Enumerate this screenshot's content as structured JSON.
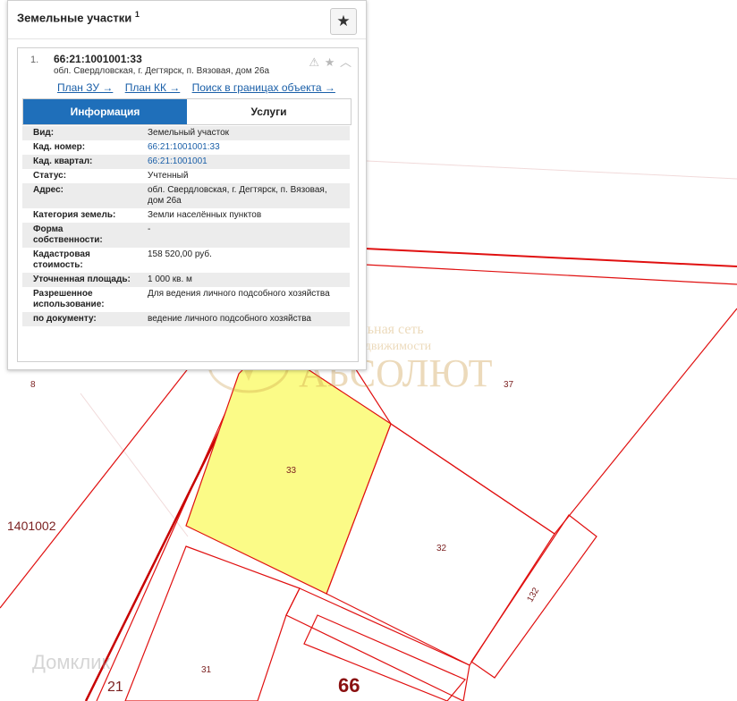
{
  "panel": {
    "title": "Земельные участки",
    "count": "1",
    "result": {
      "index": "1.",
      "cadastral_number": "66:21:1001001:33",
      "address": "обл. Свердловская, г. Дегтярск, п. Вязовая, дом 26а",
      "tool_icons": "⚠ ★ ︿",
      "links": [
        "План ЗУ →",
        "План КК →",
        "Поиск в границах объекта →"
      ],
      "tabs": [
        "Информация",
        "Услуги"
      ],
      "rows": [
        {
          "label": "Вид:",
          "value": "Земельный участок"
        },
        {
          "label": "Кад. номер:",
          "value": "66:21:1001001:33"
        },
        {
          "label": "Кад. квартал:",
          "value": "66:21:1001001"
        },
        {
          "label": "Статус:",
          "value": "Учтенный"
        },
        {
          "label": "Адрес:",
          "value": "обл. Свердловская, г. Дегтярск, п. Вязовая, дом 26а"
        },
        {
          "label": "Категория земель:",
          "value": "Земли населённых пунктов"
        },
        {
          "label": "Форма собственности:",
          "value": "-"
        },
        {
          "label": "Кадастровая стоимость:",
          "value": "158 520,00 руб."
        },
        {
          "label": "Уточненная площадь:",
          "value": "1 000 кв. м"
        },
        {
          "label": "Разрешенное использование:",
          "value": "Для ведения личного подсобного хозяйства"
        },
        {
          "label": "по документу:",
          "value": "ведение личного подсобного хозяйства"
        }
      ]
    }
  },
  "map": {
    "parcel_labels": [
      "8",
      "37",
      "33",
      "32",
      "132",
      "31",
      "1401002",
      "21",
      "66"
    ],
    "selected_parcel_color": "#fbfb87",
    "boundary_color": "#e01010",
    "watermark": {
      "line1": "Региональная сеть",
      "line2": "агентств недвижимости",
      "line3": "АБСОЛЮТ"
    },
    "domclick_watermark": "Домклик"
  }
}
